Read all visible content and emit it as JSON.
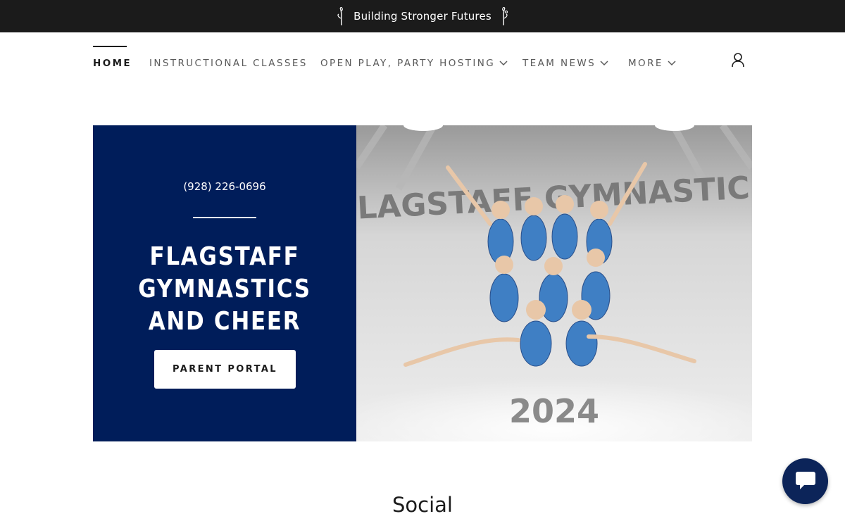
{
  "announcement": {
    "text": "Building Stronger Futures"
  },
  "nav": {
    "items": [
      {
        "label": "HOME",
        "active": true,
        "dropdown": false
      },
      {
        "label": "INSTRUCTIONAL CLASSES",
        "active": false,
        "dropdown": false
      },
      {
        "label": "OPEN PLAY, PARTY HOSTING",
        "active": false,
        "dropdown": true
      },
      {
        "label": "TEAM NEWS",
        "active": false,
        "dropdown": true
      },
      {
        "label": "MORE",
        "active": false,
        "dropdown": true
      }
    ]
  },
  "hero": {
    "phone": "(928) 226-0696",
    "title": "FLAGSTAFF GYMNASTICS AND CHEER",
    "button_label": "PARENT PORTAL",
    "image": {
      "banner_text": "FLAGSTAFF GYMNASTICS",
      "year_text": "2024"
    }
  },
  "sections": {
    "social_heading": "Social"
  },
  "colors": {
    "topbar": "#1b1b1b",
    "hero_panel": "#001d5a",
    "chat_button": "#0c2459",
    "leotard": "#3f7fc4"
  },
  "icons": [
    "flower-icon",
    "chevron-down-icon",
    "account-icon",
    "chat-icon"
  ]
}
